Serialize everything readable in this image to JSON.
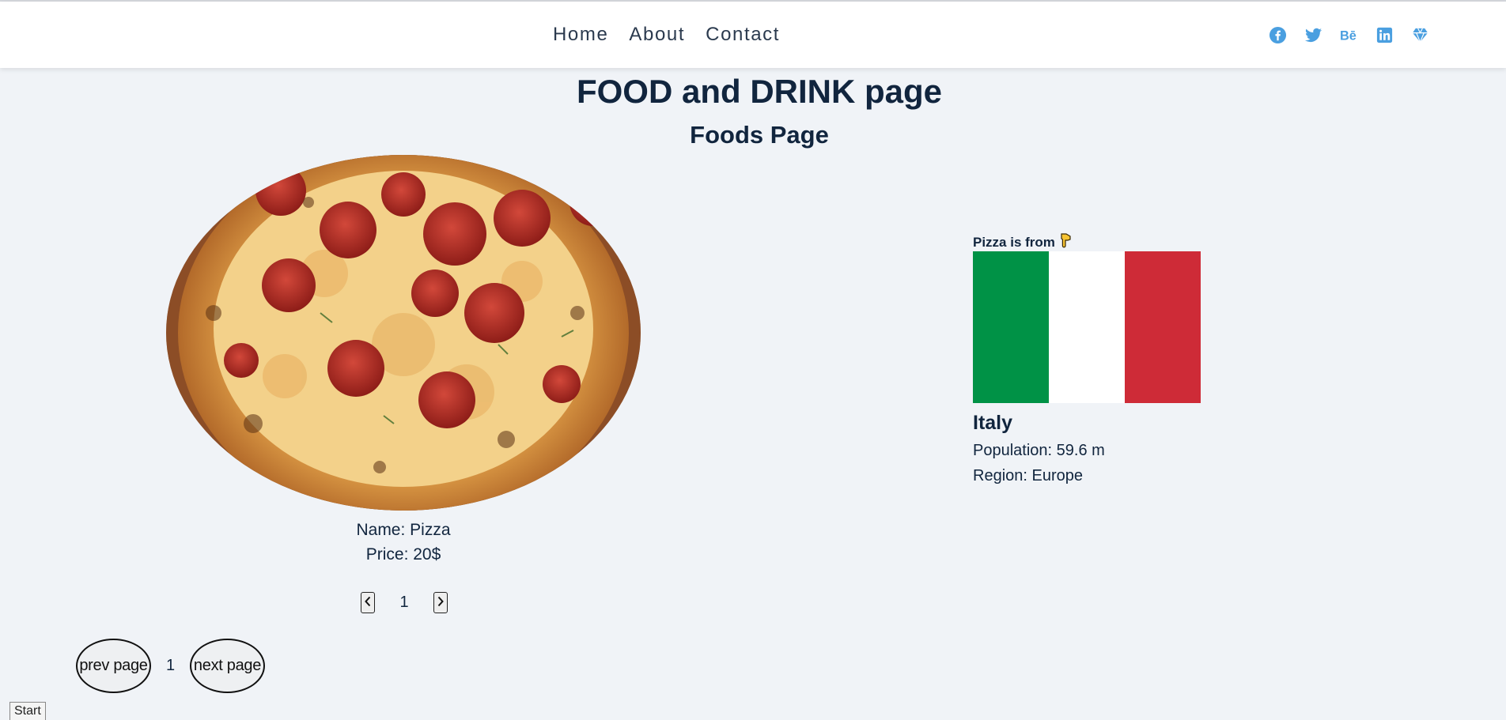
{
  "nav": {
    "links": [
      "Home",
      "About",
      "Contact"
    ],
    "social_icons": [
      "facebook-icon",
      "twitter-icon",
      "behance-icon",
      "linkedin-icon",
      "diamond-icon"
    ],
    "accent": "#4a9fe0"
  },
  "page": {
    "title": "FOOD and DRINK page",
    "subtitle": "Foods Page"
  },
  "food": {
    "name_text": "Name: Pizza",
    "price_text": "Price: 20$",
    "pager_page": "1"
  },
  "pager": {
    "prev_label": "prev page",
    "page": "1",
    "next_label": "next page"
  },
  "country": {
    "from_label": "Pizza is from",
    "pointer_icon": "hand-pointing-down-icon",
    "name": "Italy",
    "population_text": "Population: 59.6 m",
    "region_text": "Region: Europe",
    "flag_colors": [
      "#009246",
      "#ffffff",
      "#ce2b37"
    ]
  },
  "taskbar": {
    "start_label": "Start"
  }
}
